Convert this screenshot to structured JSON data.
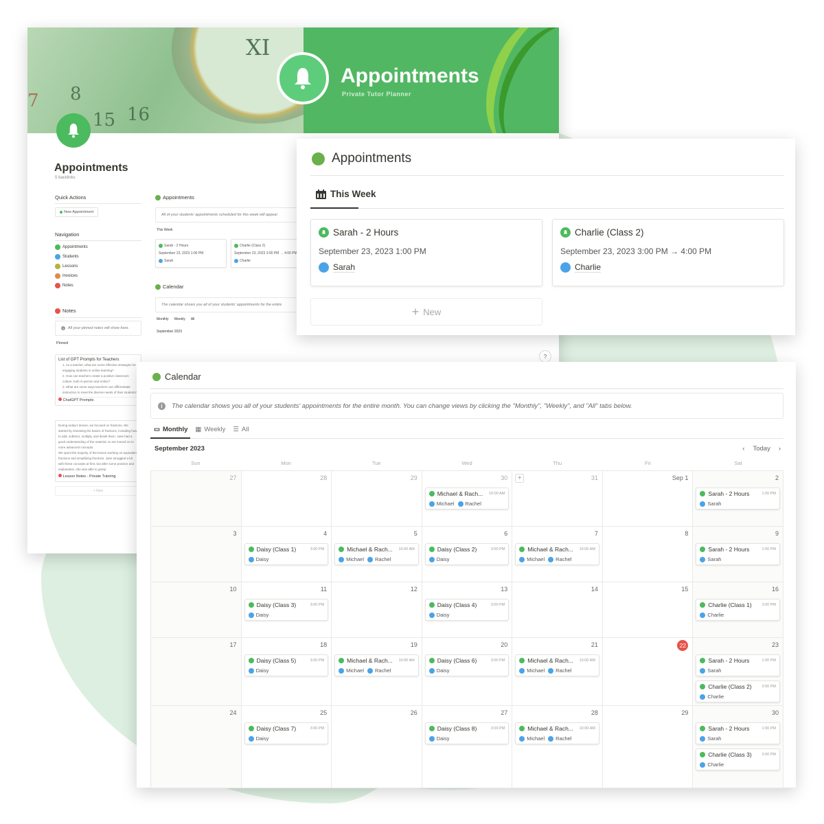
{
  "cover": {
    "title": "Appointments",
    "subtitle": "Private Tutor Planner",
    "numbers": [
      "8",
      "15",
      "16",
      "7",
      "XI"
    ]
  },
  "page": {
    "title": "Appointments",
    "backlinks": "5 backlinks"
  },
  "sidebar": {
    "quick_actions_title": "Quick Actions",
    "new_appointment": "New Appointment",
    "navigation_title": "Navigation",
    "nav_items": [
      {
        "label": "Appointments",
        "color": "#4cba5e"
      },
      {
        "label": "Students",
        "color": "#4aa3e8"
      },
      {
        "label": "Lessons",
        "color": "#b5b23a"
      },
      {
        "label": "Invoices",
        "color": "#e08a4a"
      },
      {
        "label": "Notes",
        "color": "#e5534b"
      }
    ],
    "notes_title": "Notes",
    "notes_callout": "All your pinned notes will show here.",
    "pinned": "Pinned",
    "note1": {
      "title": "List of GPT Prompts for Teachers",
      "items": [
        "1. As a teacher, what are some effective strategies for engaging students in online learning?",
        "2. How can teachers create a positive classroom culture, both in-person and online?",
        "3. What are some ways teachers can differentiate instruction to meet the diverse needs of their students?"
      ],
      "tag": "ChatGPT Prompts"
    },
    "note2": {
      "text1": "During today's lesson, we focused on fractions. We started by reviewing the basics of fractions, including how to add, subtract, multiply, and divide them. Jane had a good understanding of the material, so we moved on to more advanced concepts.",
      "text2": "We spent the majority of the lesson working on equivalent fractions and simplifying fractions. Jane struggled a bit with these concepts at first, but after some practice and explanation, she was able to grasp",
      "tag": "Lesson Notes - Private Tutoring"
    },
    "new_label": "+ New"
  },
  "back_main": {
    "appointments_title": "Appointments",
    "appointments_callout": "All of your students' appointments scheduled for this week will appear",
    "this_week": "This Week",
    "calendar_title": "Calendar",
    "calendar_callout": "The calendar shows you all of your students' appointments for the entire",
    "tabs": [
      "Monthly",
      "Weekly",
      "All"
    ],
    "month": "September 2023",
    "help": "?"
  },
  "appointments": {
    "title": "Appointments",
    "tab": "This Week",
    "cards": [
      {
        "title": "Sarah - 2 Hours",
        "date": "September 23, 2023 1:00 PM",
        "person": "Sarah"
      },
      {
        "title": "Charlie (Class 2)",
        "date": "September 23, 2023 3:00 PM → 4:00 PM",
        "person": "Charlie"
      }
    ],
    "new_label": "New"
  },
  "calendar": {
    "title": "Calendar",
    "callout": "The calendar shows you all of your students' appointments for the entire month. You can change views by clicking the \"Monthly\", \"Weekly\", and \"All\" tabs below.",
    "tabs": [
      {
        "label": "Monthly",
        "active": true
      },
      {
        "label": "Weekly",
        "active": false
      },
      {
        "label": "All",
        "active": false
      }
    ],
    "month": "September 2023",
    "today_label": "Today",
    "weekdays": [
      "Sun",
      "Mon",
      "Tue",
      "Wed",
      "Thu",
      "Fri",
      "Sat"
    ],
    "today_date": "22",
    "weeks": [
      [
        {
          "day": "27",
          "other": true,
          "events": []
        },
        {
          "day": "28",
          "other": true,
          "events": []
        },
        {
          "day": "29",
          "other": true,
          "events": []
        },
        {
          "day": "30",
          "other": true,
          "events": [
            {
              "title": "Michael & Rach...",
              "time": "10:00 AM",
              "people": [
                "Michael",
                "Rachel"
              ]
            }
          ]
        },
        {
          "day": "31",
          "other": true,
          "plus": true,
          "events": []
        },
        {
          "day": "Sep 1",
          "events": []
        },
        {
          "day": "2",
          "events": [
            {
              "title": "Sarah - 2 Hours",
              "time": "1:00 PM",
              "people": [
                "Sarah"
              ]
            }
          ]
        }
      ],
      [
        {
          "day": "3",
          "events": []
        },
        {
          "day": "4",
          "events": [
            {
              "title": "Daisy (Class 1)",
              "time": "3:00 PM",
              "people": [
                "Daisy"
              ]
            }
          ]
        },
        {
          "day": "5",
          "events": [
            {
              "title": "Michael & Rach...",
              "time": "10:00 AM",
              "people": [
                "Michael",
                "Rachel"
              ]
            }
          ]
        },
        {
          "day": "6",
          "events": [
            {
              "title": "Daisy (Class 2)",
              "time": "3:00 PM",
              "people": [
                "Daisy"
              ]
            }
          ]
        },
        {
          "day": "7",
          "events": [
            {
              "title": "Michael & Rach...",
              "time": "10:00 AM",
              "people": [
                "Michael",
                "Rachel"
              ]
            }
          ]
        },
        {
          "day": "8",
          "events": []
        },
        {
          "day": "9",
          "events": [
            {
              "title": "Sarah - 2 Hours",
              "time": "1:00 PM",
              "people": [
                "Sarah"
              ]
            }
          ]
        }
      ],
      [
        {
          "day": "10",
          "events": []
        },
        {
          "day": "11",
          "events": [
            {
              "title": "Daisy (Class 3)",
              "time": "3:00 PM",
              "people": [
                "Daisy"
              ]
            }
          ]
        },
        {
          "day": "12",
          "events": []
        },
        {
          "day": "13",
          "events": [
            {
              "title": "Daisy (Class 4)",
              "time": "3:00 PM",
              "people": [
                "Daisy"
              ]
            }
          ]
        },
        {
          "day": "14",
          "events": []
        },
        {
          "day": "15",
          "events": []
        },
        {
          "day": "16",
          "events": [
            {
              "title": "Charlie (Class 1)",
              "time": "3:00 PM",
              "people": [
                "Charlie"
              ]
            }
          ]
        }
      ],
      [
        {
          "day": "17",
          "events": []
        },
        {
          "day": "18",
          "events": [
            {
              "title": "Daisy (Class 5)",
              "time": "3:00 PM",
              "people": [
                "Daisy"
              ]
            }
          ]
        },
        {
          "day": "19",
          "events": [
            {
              "title": "Michael & Rach...",
              "time": "10:00 AM",
              "people": [
                "Michael",
                "Rachel"
              ]
            }
          ]
        },
        {
          "day": "20",
          "events": [
            {
              "title": "Daisy (Class 6)",
              "time": "3:00 PM",
              "people": [
                "Daisy"
              ]
            }
          ]
        },
        {
          "day": "21",
          "events": [
            {
              "title": "Michael & Rach...",
              "time": "10:00 AM",
              "people": [
                "Michael",
                "Rachel"
              ]
            }
          ]
        },
        {
          "day": "22",
          "today": true,
          "events": []
        },
        {
          "day": "23",
          "events": [
            {
              "title": "Sarah - 2 Hours",
              "time": "1:00 PM",
              "people": [
                "Sarah"
              ]
            },
            {
              "title": "Charlie (Class 2)",
              "time": "3:00 PM",
              "people": [
                "Charlie"
              ]
            }
          ]
        }
      ],
      [
        {
          "day": "24",
          "events": []
        },
        {
          "day": "25",
          "events": [
            {
              "title": "Daisy (Class 7)",
              "time": "3:00 PM",
              "people": [
                "Daisy"
              ]
            }
          ]
        },
        {
          "day": "26",
          "events": []
        },
        {
          "day": "27",
          "events": [
            {
              "title": "Daisy (Class 8)",
              "time": "3:00 PM",
              "people": [
                "Daisy"
              ]
            }
          ]
        },
        {
          "day": "28",
          "events": [
            {
              "title": "Michael & Rach...",
              "time": "10:00 AM",
              "people": [
                "Michael",
                "Rachel"
              ]
            }
          ]
        },
        {
          "day": "29",
          "events": []
        },
        {
          "day": "30",
          "events": [
            {
              "title": "Sarah - 2 Hours",
              "time": "1:00 PM",
              "people": [
                "Sarah"
              ]
            },
            {
              "title": "Charlie (Class 3)",
              "time": "3:00 PM",
              "people": [
                "Charlie"
              ]
            }
          ]
        }
      ]
    ]
  }
}
